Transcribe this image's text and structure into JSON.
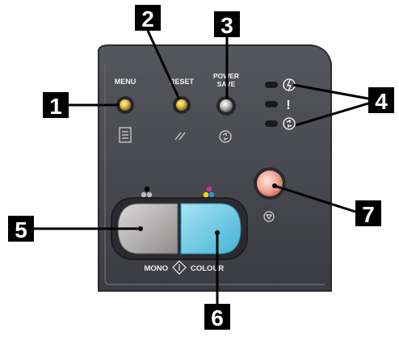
{
  "panel": {
    "buttons": {
      "menu": {
        "label": "Menu"
      },
      "reset": {
        "label": "Reset"
      },
      "power_save": {
        "label_line1": "Power",
        "label_line2": "Save"
      }
    },
    "indicators": [
      {
        "name": "ready",
        "symbol": "power"
      },
      {
        "name": "attention",
        "symbol": "!"
      },
      {
        "name": "data",
        "symbol": "refresh"
      }
    ],
    "start_labels": {
      "mono": "Mono",
      "colour": "Colour"
    }
  },
  "callouts": [
    "1",
    "2",
    "3",
    "4",
    "5",
    "6",
    "7"
  ],
  "colors": {
    "panel_dark": "#3a3a42",
    "panel_mid": "#4b4b54",
    "accent_yellow": "#e6c040",
    "mono_button": "#b8b6b6",
    "colour_button": "#73cfe8",
    "stop_button": "#f4b0a0",
    "callout_bg": "#000000",
    "callout_fg": "#ffffff"
  }
}
